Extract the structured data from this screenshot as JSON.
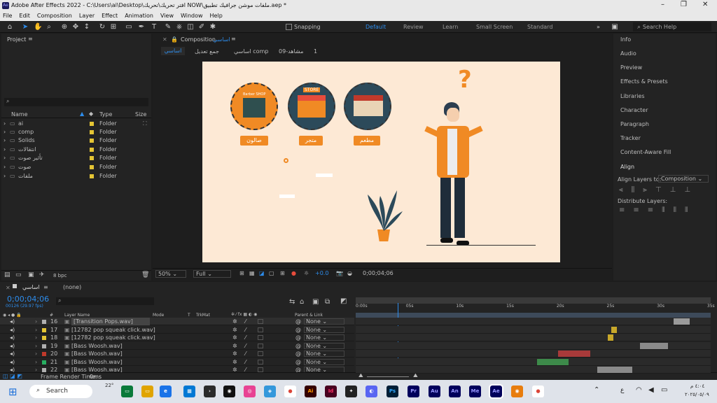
{
  "window": {
    "app_badge": "Ae",
    "title": "Adobe After Effects 2022 - C:\\Users\\ai\\Desktop\\افتر تحريك\\تحريك NOW\\ملفات موشن جرافيك تطبيق.aep *"
  },
  "menu": [
    "File",
    "Edit",
    "Composition",
    "Layer",
    "Effect",
    "Animation",
    "View",
    "Window",
    "Help"
  ],
  "toolbar": {
    "snapping": "Snapping",
    "workspaces": [
      "Default",
      "Review",
      "Learn",
      "Small Screen",
      "Standard"
    ],
    "help_placeholder": "Search Help"
  },
  "project": {
    "title": "Project",
    "columns": {
      "name": "Name",
      "type": "Type",
      "size": "Size"
    },
    "items": [
      {
        "name": "ai",
        "type": "Folder"
      },
      {
        "name": "comp",
        "type": "Folder"
      },
      {
        "name": "Solids",
        "type": "Folder"
      },
      {
        "name": "انتقالات",
        "type": "Folder"
      },
      {
        "name": "تأثير صوت",
        "type": "Folder"
      },
      {
        "name": "صوت",
        "type": "Folder"
      },
      {
        "name": "ملفات",
        "type": "Folder"
      }
    ],
    "bpc": "8 bpc"
  },
  "composition": {
    "panel_label": "Composition",
    "comp_name": "اساسي",
    "breadcrumbs": [
      "اساسي",
      "جمع تعديل",
      "اساسي comp",
      "مشاهد-09",
      "1"
    ],
    "zoom": "50%",
    "resolution": "Full",
    "exposure": "+0.0",
    "timecode": "0;00;04;06"
  },
  "artwork": {
    "question": "?",
    "stores": [
      {
        "label": "صالون",
        "sign": "Barber SHOP"
      },
      {
        "label": "متجر",
        "sign": "STORE"
      },
      {
        "label": "مطعم",
        "sign": ""
      }
    ]
  },
  "right_panel": {
    "items": [
      "Info",
      "Audio",
      "Preview",
      "Effects & Presets",
      "Libraries",
      "Character",
      "Paragraph",
      "Tracker",
      "Content-Aware Fill"
    ],
    "align": {
      "title": "Align",
      "align_to_label": "Align Layers to:",
      "align_to_value": "Composition",
      "distribute": "Distribute Layers:"
    }
  },
  "timeline": {
    "tab": "اساسي",
    "none_tab": "(none)",
    "timecode": "0;00;04;06",
    "timecode_sub": "00126 (29.97 fps)",
    "columns": {
      "layer_name": "Layer Name",
      "mode": "Mode",
      "t": "T",
      "trkmat": "TrkMat",
      "parent": "Parent & Link",
      "num": "#"
    },
    "ruler": [
      "0:00s",
      "05s",
      "10s",
      "15s",
      "20s",
      "25s",
      "30s",
      "35s"
    ],
    "playhead_fraction": 0.119,
    "layers": [
      {
        "num": "16",
        "name": "[Transition Pops.wav]",
        "color": "#b0b0b0",
        "parent": "None",
        "bar_start": 0.895,
        "bar_end": 0.94,
        "bar_color": "#9a9a9a"
      },
      {
        "num": "17",
        "name": "[12782 pop squeak click.wav]",
        "color": "#e5c534",
        "parent": "None",
        "bar_start": 0.72,
        "bar_end": 0.735,
        "bar_color": "#c8a82a"
      },
      {
        "num": "18",
        "name": "[12782 pop squeak click.wav]",
        "color": "#e5c534",
        "parent": "None",
        "bar_start": 0.71,
        "bar_end": 0.725,
        "bar_color": "#c8a82a"
      },
      {
        "num": "19",
        "name": "[Bass Woosh.wav]",
        "color": "#b0b0b0",
        "parent": "None",
        "bar_start": 0.8,
        "bar_end": 0.88,
        "bar_color": "#8a8a8a"
      },
      {
        "num": "20",
        "name": "[Bass Woosh.wav]",
        "color": "#c0392b",
        "parent": "None",
        "bar_start": 0.57,
        "bar_end": 0.66,
        "bar_color": "#a83a3a"
      },
      {
        "num": "21",
        "name": "[Bass Woosh.wav]",
        "color": "#27ae60",
        "parent": "None",
        "bar_start": 0.51,
        "bar_end": 0.6,
        "bar_color": "#3d8a4a"
      },
      {
        "num": "22",
        "name": "[Bass Woosh.wav]",
        "color": "#b0b0b0",
        "parent": "None",
        "bar_start": 0.68,
        "bar_end": 0.78,
        "bar_color": "#8a8a8a"
      }
    ],
    "footer": {
      "label": "Frame Render Time:",
      "value": "0ms"
    }
  },
  "taskbar": {
    "weather": "22°",
    "search": "Search",
    "clock_time": "٤:٠٤ م",
    "clock_date": "٢٠٢٥/٠٥/٠٩",
    "lang": "ع"
  }
}
